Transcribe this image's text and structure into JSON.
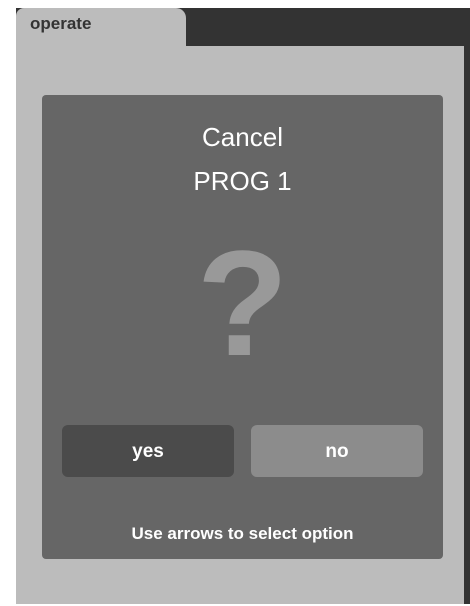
{
  "tab": {
    "label": "operate"
  },
  "dialog": {
    "title_line1": "Cancel",
    "title_line2": "PROG 1",
    "icon": "question-mark-icon",
    "icon_glyph": "?",
    "yes_label": "yes",
    "no_label": "no",
    "hint": "Use arrows to select option"
  },
  "colors": {
    "background": "#bcbcbc",
    "dialog": "#666666",
    "selected_button": "#4b4b4b",
    "unselected_button": "#8c8c8c",
    "text": "#ffffff",
    "tab_bar": "#333333"
  }
}
